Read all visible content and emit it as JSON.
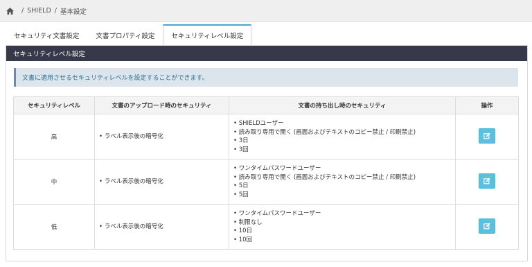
{
  "breadcrumb": {
    "items": [
      "SHIELD",
      "基本設定"
    ],
    "separator": "/"
  },
  "tabs": [
    {
      "label": "セキュリティ文書設定",
      "active": false
    },
    {
      "label": "文書プロパティ設定",
      "active": false
    },
    {
      "label": "セキュリティレベル設定",
      "active": true
    }
  ],
  "panel": {
    "title": "セキュリティレベル設定",
    "info": "文書に適用させるセキュリティレベルを設定することができます。"
  },
  "table": {
    "headers": [
      "セキュリティレベル",
      "文書のアップロード時のセキュリティ",
      "文書の持ち出し時のセキュリティ",
      "操作"
    ],
    "rows": [
      {
        "level": "高",
        "upload": [
          "ラベル表示後の暗号化"
        ],
        "export": [
          "SHIELDユーザー",
          "読み取り専用で開く (画面およびテキストのコピー禁止 / 印刷禁止)",
          "3日",
          "3回"
        ]
      },
      {
        "level": "中",
        "upload": [
          "ラベル表示後の暗号化"
        ],
        "export": [
          "ワンタイムパスワードユーザー",
          "読み取り専用で開く (画面およびテキストのコピー禁止 / 印刷禁止)",
          "5日",
          "5回"
        ]
      },
      {
        "level": "低",
        "upload": [
          "ラベル表示後の暗号化"
        ],
        "export": [
          "ワンタイムパスワードユーザー",
          "制限なし",
          "10日",
          "10回"
        ]
      }
    ]
  },
  "icons": {
    "home": "home-icon",
    "edit": "edit-icon"
  },
  "colors": {
    "header_bg": "#37394a",
    "accent": "#4aa8c9",
    "edit_button": "#5bc0de",
    "info_bg": "#dce4ec"
  }
}
